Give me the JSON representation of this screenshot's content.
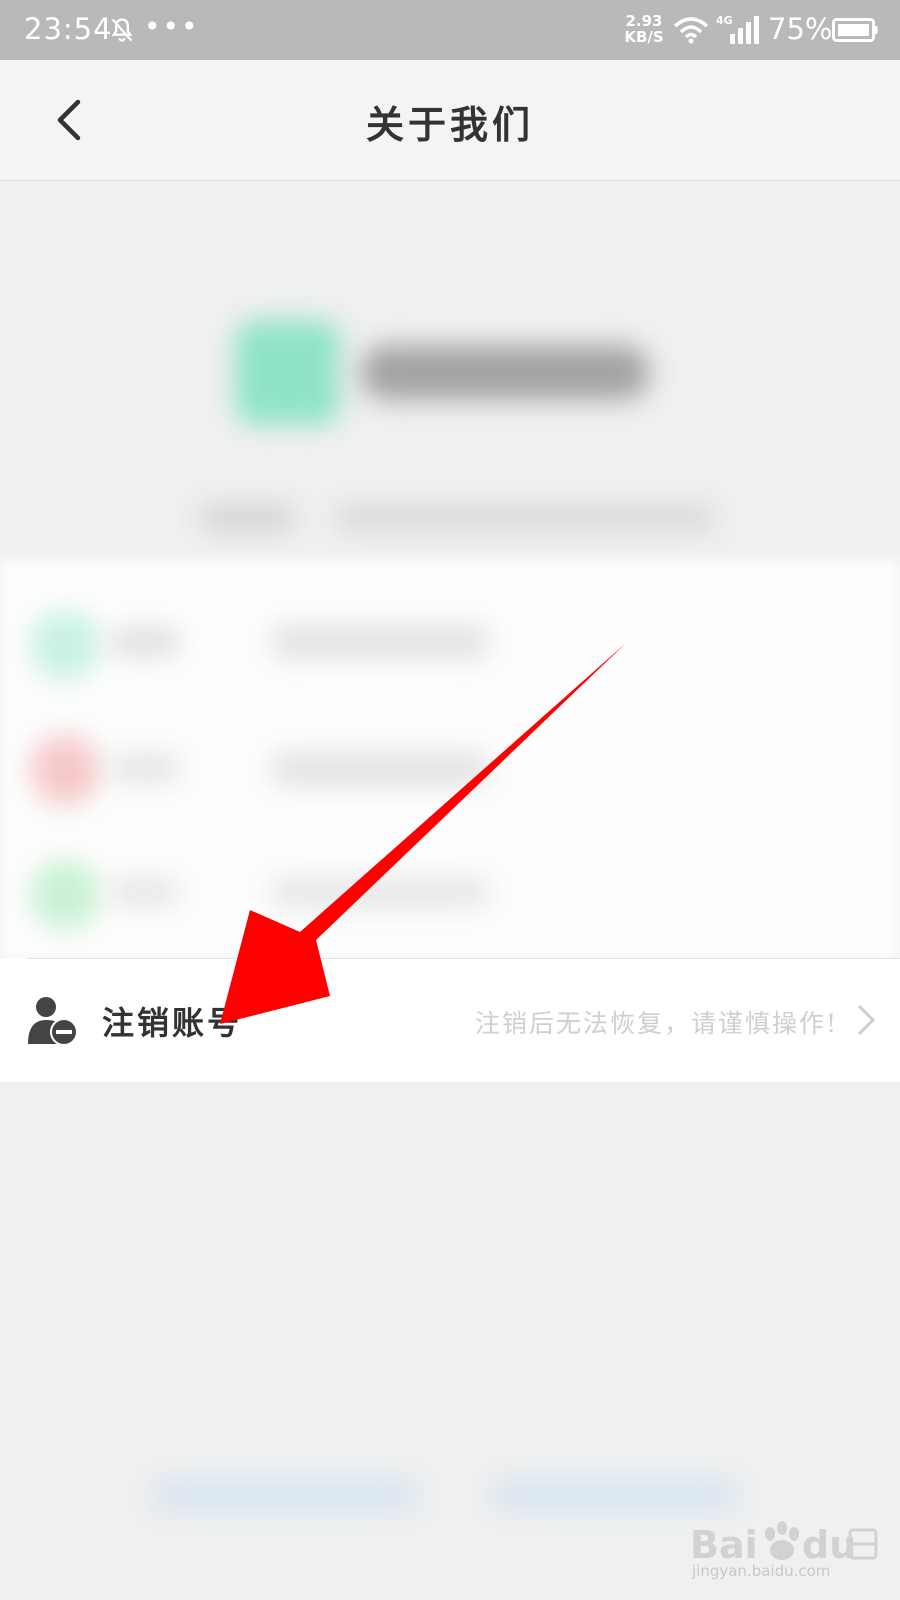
{
  "status_bar": {
    "time": "23:54",
    "dots": "•••",
    "speed_value": "2.93",
    "speed_unit": "KB/S",
    "network_type": "4G",
    "battery_percent": "75%",
    "icons": [
      "bell-off-icon",
      "wifi-icon",
      "signal-icon",
      "battery-icon"
    ]
  },
  "navbar": {
    "title": "关于我们",
    "back_icon": "chevron-left-icon"
  },
  "cancel_row": {
    "title": "注销账号",
    "hint": "注销后无法恢复，请谨慎操作!",
    "icon": "user-minus-icon",
    "chevron_icon": "chevron-right-icon"
  },
  "colors": {
    "statusbar_bg": "#b9b9b9",
    "navbar_bg": "#f4f4f4",
    "page_bg": "#f0f0f0",
    "annotation_arrow": "#ff0000"
  }
}
